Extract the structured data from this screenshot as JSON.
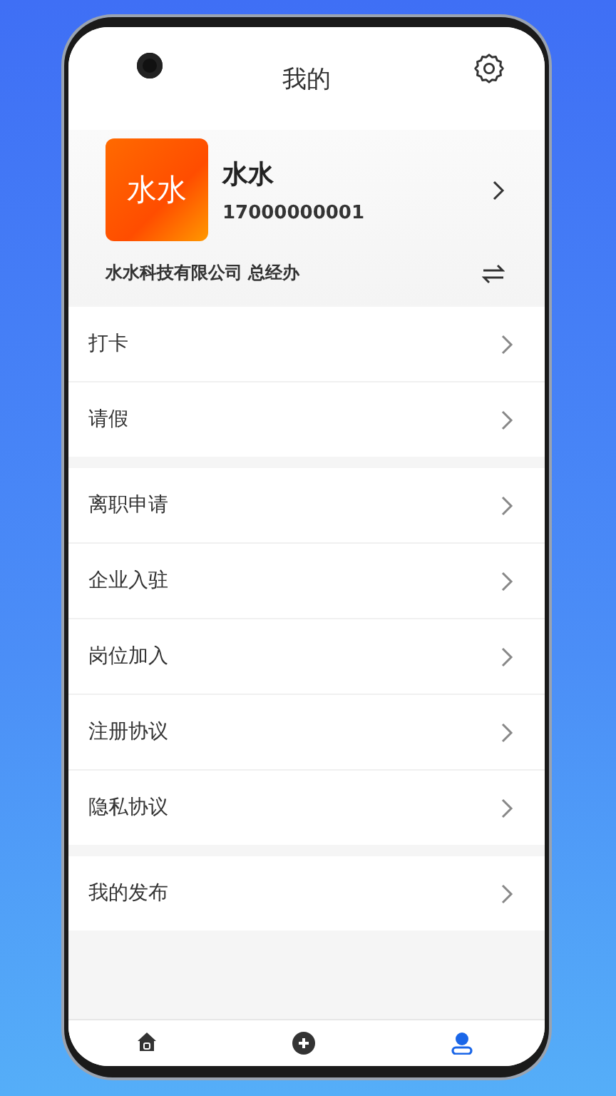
{
  "header": {
    "title": "我的"
  },
  "profile": {
    "avatar_text": "水水",
    "name": "水水",
    "phone": "17000000001",
    "company": "水水科技有限公司 总经办"
  },
  "menu_groups": [
    {
      "items": [
        {
          "label": "打卡"
        },
        {
          "label": "请假"
        }
      ]
    },
    {
      "items": [
        {
          "label": "离职申请"
        },
        {
          "label": "企业入驻"
        },
        {
          "label": "岗位加入"
        },
        {
          "label": "注册协议"
        },
        {
          "label": "隐私协议"
        }
      ]
    },
    {
      "items": [
        {
          "label": "我的发布"
        }
      ]
    }
  ],
  "tab_bar": [
    {
      "kind": "home",
      "selected": false
    },
    {
      "kind": "add",
      "selected": false
    },
    {
      "kind": "profile",
      "selected": true
    }
  ]
}
